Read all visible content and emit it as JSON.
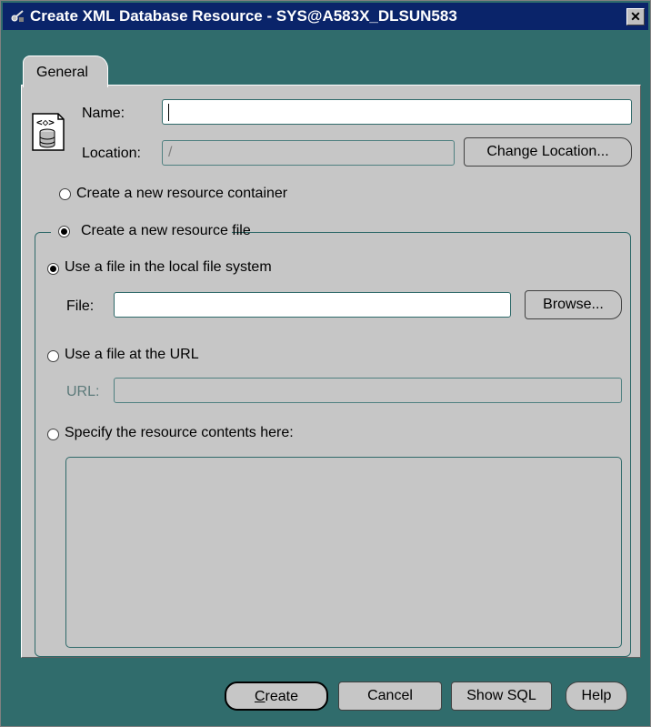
{
  "window": {
    "title": "Create XML Database Resource - SYS@A583X_DLSUN583",
    "close_symbol": "✕"
  },
  "tabs": [
    {
      "label": "General",
      "selected": true
    }
  ],
  "form": {
    "name_label": "Name:",
    "name_value": "",
    "location_label": "Location:",
    "location_value": "/",
    "change_location_button": "Change Location..."
  },
  "options": {
    "container_label": "Create a new resource container",
    "file_group_label": "Create a new resource file",
    "local_file_label": "Use a file in the local file system",
    "file_label": "File:",
    "file_value": "",
    "browse_button": "Browse...",
    "url_option_label": "Use a file at the URL",
    "url_label": "URL:",
    "url_value": "",
    "contents_label": "Specify the resource contents here:",
    "contents_value": ""
  },
  "buttons": {
    "create_mnemonic": "C",
    "create_rest": "reate",
    "cancel": "Cancel",
    "show_sql": "Show SQL",
    "help": "Help"
  },
  "colors": {
    "title_bar": "#0a246a",
    "frame": "#306c6c",
    "panel": "#c6c6c6"
  },
  "icons": {
    "window": "xml-tools-icon",
    "resource": "xml-database-resource-icon"
  }
}
